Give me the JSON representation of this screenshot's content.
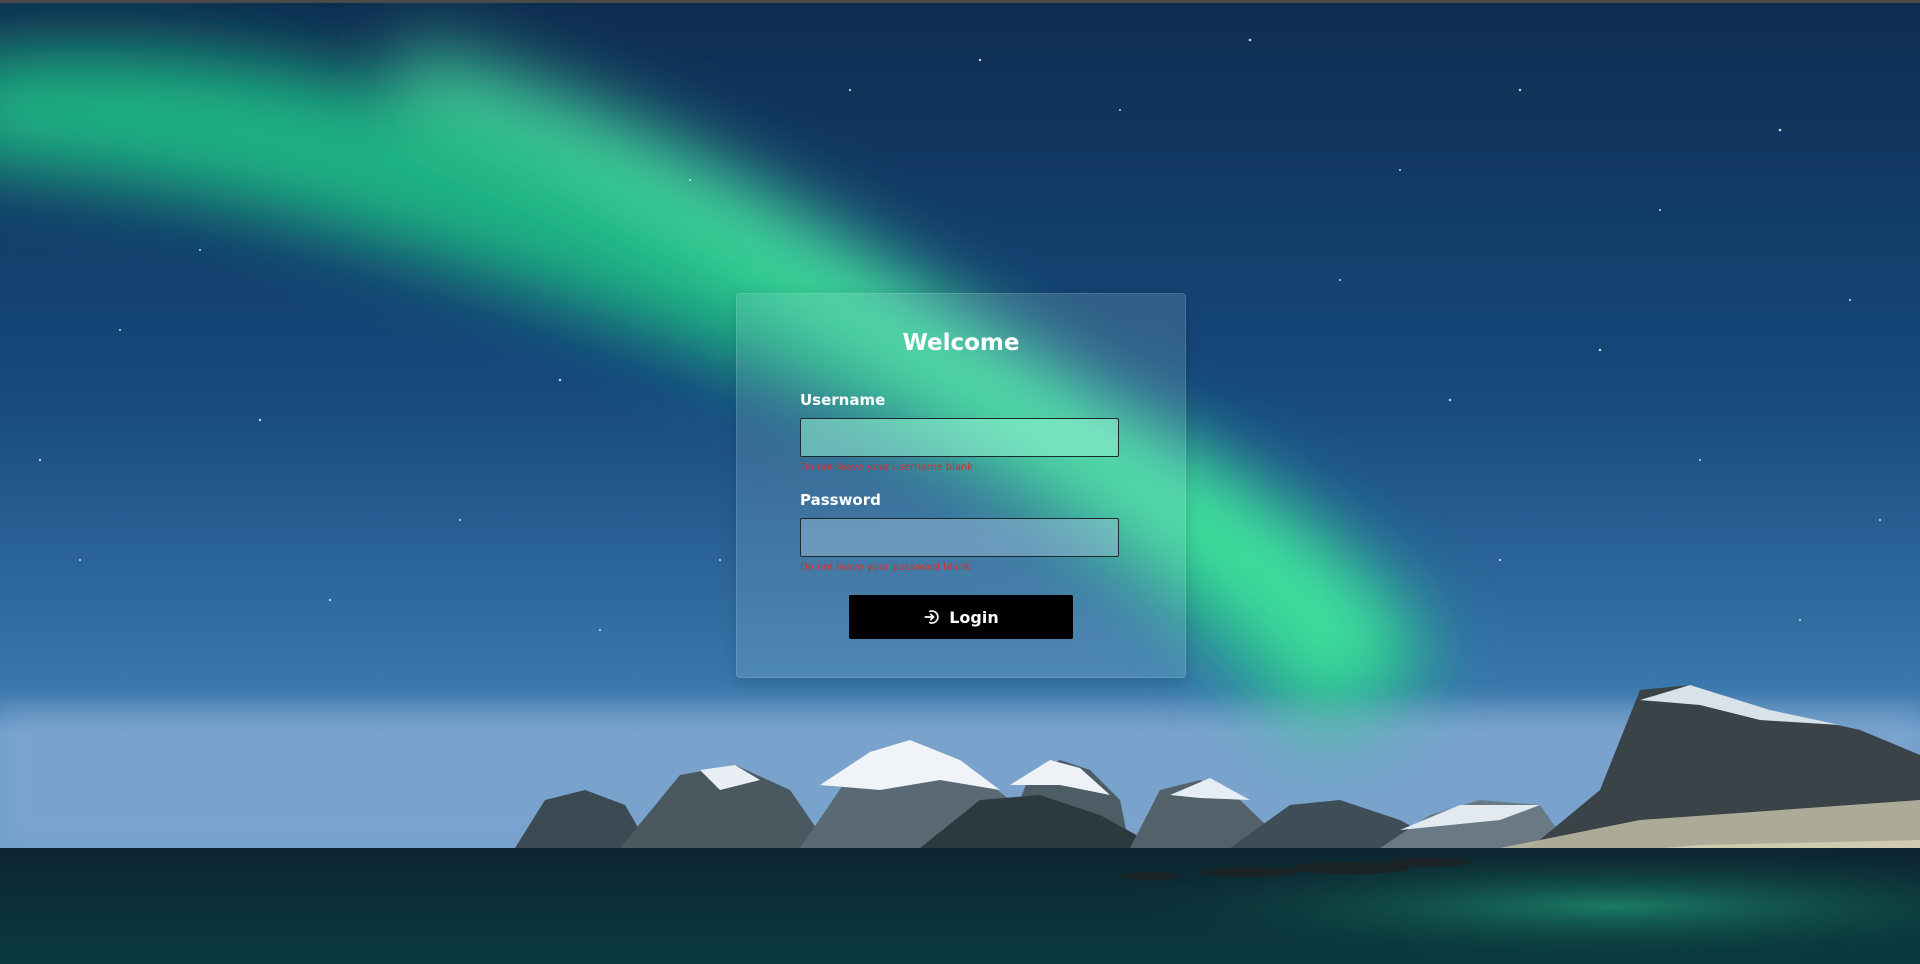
{
  "login": {
    "title": "Welcome",
    "username": {
      "label": "Username",
      "value": "",
      "placeholder": "",
      "error": "Do not leave your username blank"
    },
    "password": {
      "label": "Password",
      "value": "",
      "placeholder": "",
      "error": "Do not leave your password blank"
    },
    "button": {
      "label": "Login",
      "icon": "login-icon"
    }
  },
  "colors": {
    "error": "#d0312d",
    "button": "#000000",
    "button_text": "#ffffff",
    "title": "#ffffff"
  }
}
